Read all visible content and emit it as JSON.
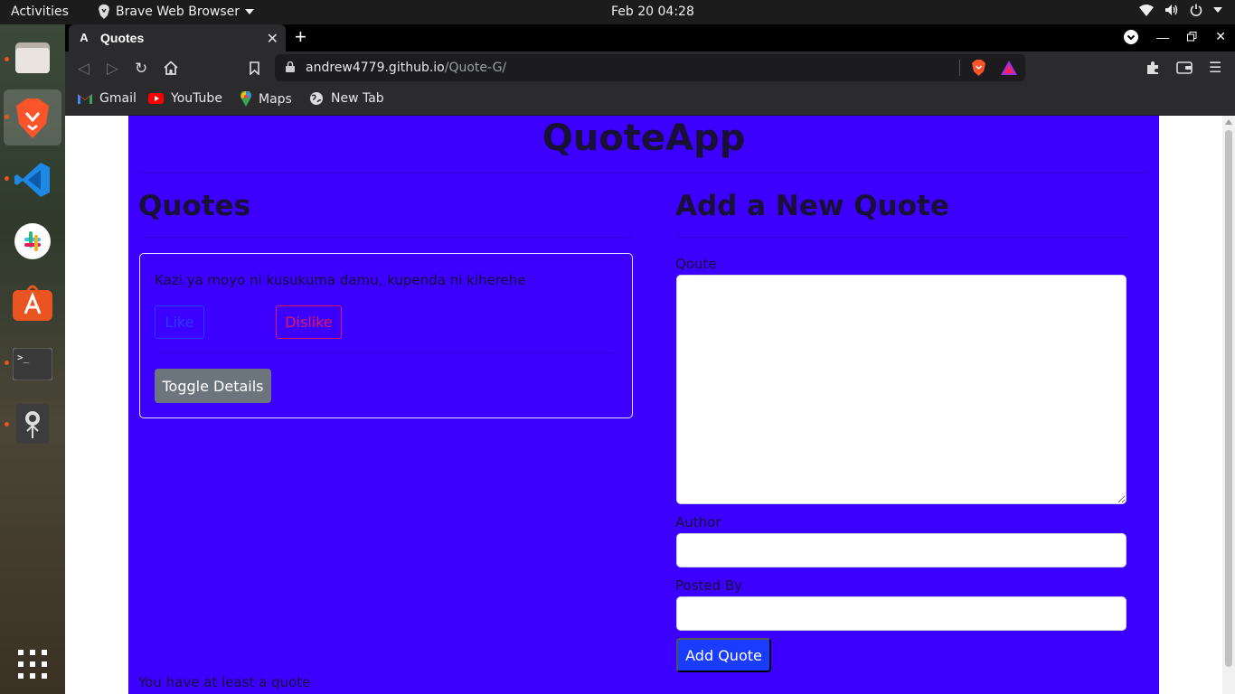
{
  "topbar": {
    "activities": "Activities",
    "app_name": "Brave Web Browser",
    "datetime": "Feb 20  04:28"
  },
  "dock": {
    "items": [
      "files-icon",
      "brave-icon",
      "vscode-icon",
      "slack-icon",
      "software-icon",
      "terminal-icon",
      "webcam-icon",
      "app-grid-icon"
    ]
  },
  "browser": {
    "tab_title": "Quotes",
    "tab_favicon": "A",
    "url_host": "andrew4779.github.io",
    "url_path": "/Quote-G/",
    "bookmarks": [
      "Gmail",
      "YouTube",
      "Maps",
      "New Tab"
    ]
  },
  "page": {
    "title": "QuoteApp",
    "quotes_heading": "Quotes",
    "add_heading": "Add a New Quote",
    "quote": {
      "text": "Kazi ya moyo ni kusukuma damu, kupenda ni kiherehe",
      "like_label": "Like",
      "dislike_label": "Dislike",
      "toggle_label": "Toggle Details"
    },
    "footer_text": "You have at least a quote",
    "form": {
      "quote_label": "Qoute",
      "author_label": "Author",
      "posted_by_label": "Posted By",
      "quote_value": "",
      "author_value": "",
      "posted_by_value": "",
      "submit_label": "Add Quote"
    }
  },
  "colors": {
    "page_bg": "#3b00ff",
    "like": "#2a3cff",
    "dislike": "#e0185a",
    "toggle": "#6c757d",
    "submit": "#1a3cff"
  }
}
